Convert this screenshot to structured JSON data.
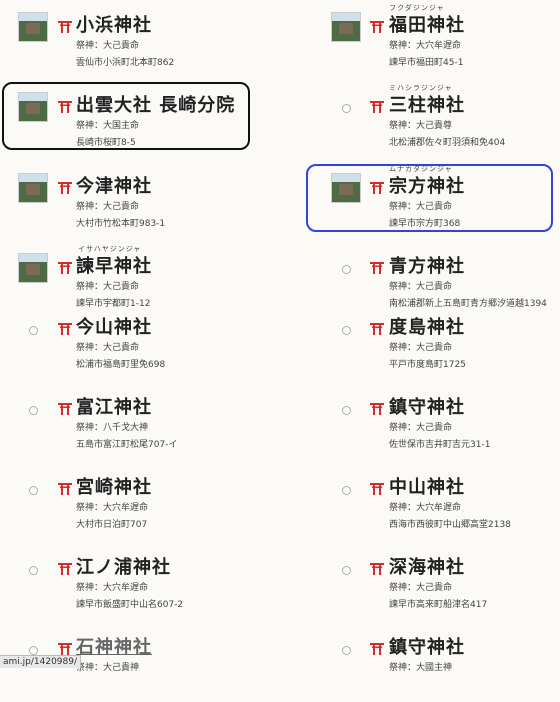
{
  "colors": {
    "torii": "#d62b2b",
    "highlight_black": "#111111",
    "highlight_blue": "#3344dd"
  },
  "left": [
    {
      "name": "小浜神社",
      "furigana": "",
      "deity": "祭神：大己貴命",
      "address": "雲仙市小浜町北本町862",
      "thumb": true,
      "link": false
    },
    {
      "name": "出雲大社 長崎分院",
      "furigana": "",
      "deity": "祭神：大国主命",
      "address": "長崎市桜町8-5",
      "thumb": true,
      "link": false
    },
    {
      "name": "今津神社",
      "furigana": "",
      "deity": "祭神：大己貴命",
      "address": "大村市竹松本町983-1",
      "thumb": true,
      "link": false
    },
    {
      "name": "諫早神社",
      "furigana": "イサハヤジンジャ",
      "deity": "祭神：大己貴命",
      "address": "諫早市宇都町1-12",
      "thumb": true,
      "link": false
    },
    {
      "name": "今山神社",
      "furigana": "",
      "deity": "祭神：大己貴命",
      "address": "松浦市福島町里免698",
      "thumb": false,
      "link": false
    },
    {
      "name": "富江神社",
      "furigana": "",
      "deity": "祭神：八千戈大神",
      "address": "五島市富江町松尾707-イ",
      "thumb": false,
      "link": false
    },
    {
      "name": "宮崎神社",
      "furigana": "",
      "deity": "祭神：大穴牟遅命",
      "address": "大村市日泊町707",
      "thumb": false,
      "link": false
    },
    {
      "name": "江ノ浦神社",
      "furigana": "",
      "deity": "祭神：大穴牟遅命",
      "address": "諫早市飯盛町中山名607-2",
      "thumb": false,
      "link": false
    },
    {
      "name": "石神神社",
      "furigana": "",
      "deity": "祭神：大己貴神",
      "address": "",
      "thumb": false,
      "link": true
    }
  ],
  "right": [
    {
      "name": "福田神社",
      "furigana": "フクダジンジャ",
      "deity": "祭神：大穴牟遅命",
      "address": "諫早市福田町45-1",
      "thumb": true
    },
    {
      "name": "三柱神社",
      "furigana": "ミハシラジンジャ",
      "deity": "祭神：大己貴尊",
      "address": "北松浦郡佐々町羽須和免404",
      "thumb": false
    },
    {
      "name": "宗方神社",
      "furigana": "ムナカタジンジャ",
      "deity": "祭神：大己貴命",
      "address": "諫早市宗方町368",
      "thumb": true
    },
    {
      "name": "青方神社",
      "furigana": "",
      "deity": "祭神：大己貴命",
      "address": "南松浦郡新上五島町青方郷汐道越1394",
      "thumb": false
    },
    {
      "name": "度島神社",
      "furigana": "",
      "deity": "祭神：大己貴命",
      "address": "平戸市度島町1725",
      "thumb": false
    },
    {
      "name": "鎮守神社",
      "furigana": "",
      "deity": "祭神：大己貴命",
      "address": "佐世保市吉井町吉元31-1",
      "thumb": false
    },
    {
      "name": "中山神社",
      "furigana": "",
      "deity": "祭神：大穴牟遅命",
      "address": "西海市西彼町中山郷高堂2138",
      "thumb": false
    },
    {
      "name": "深海神社",
      "furigana": "",
      "deity": "祭神：大己貴命",
      "address": "諫早市高来町船津名417",
      "thumb": false
    },
    {
      "name": "鎮守神社",
      "furigana": "",
      "deity": "祭神：大國主神",
      "address": "",
      "thumb": false
    }
  ],
  "status_bar": {
    "url": "ami.jp/1420989/"
  }
}
